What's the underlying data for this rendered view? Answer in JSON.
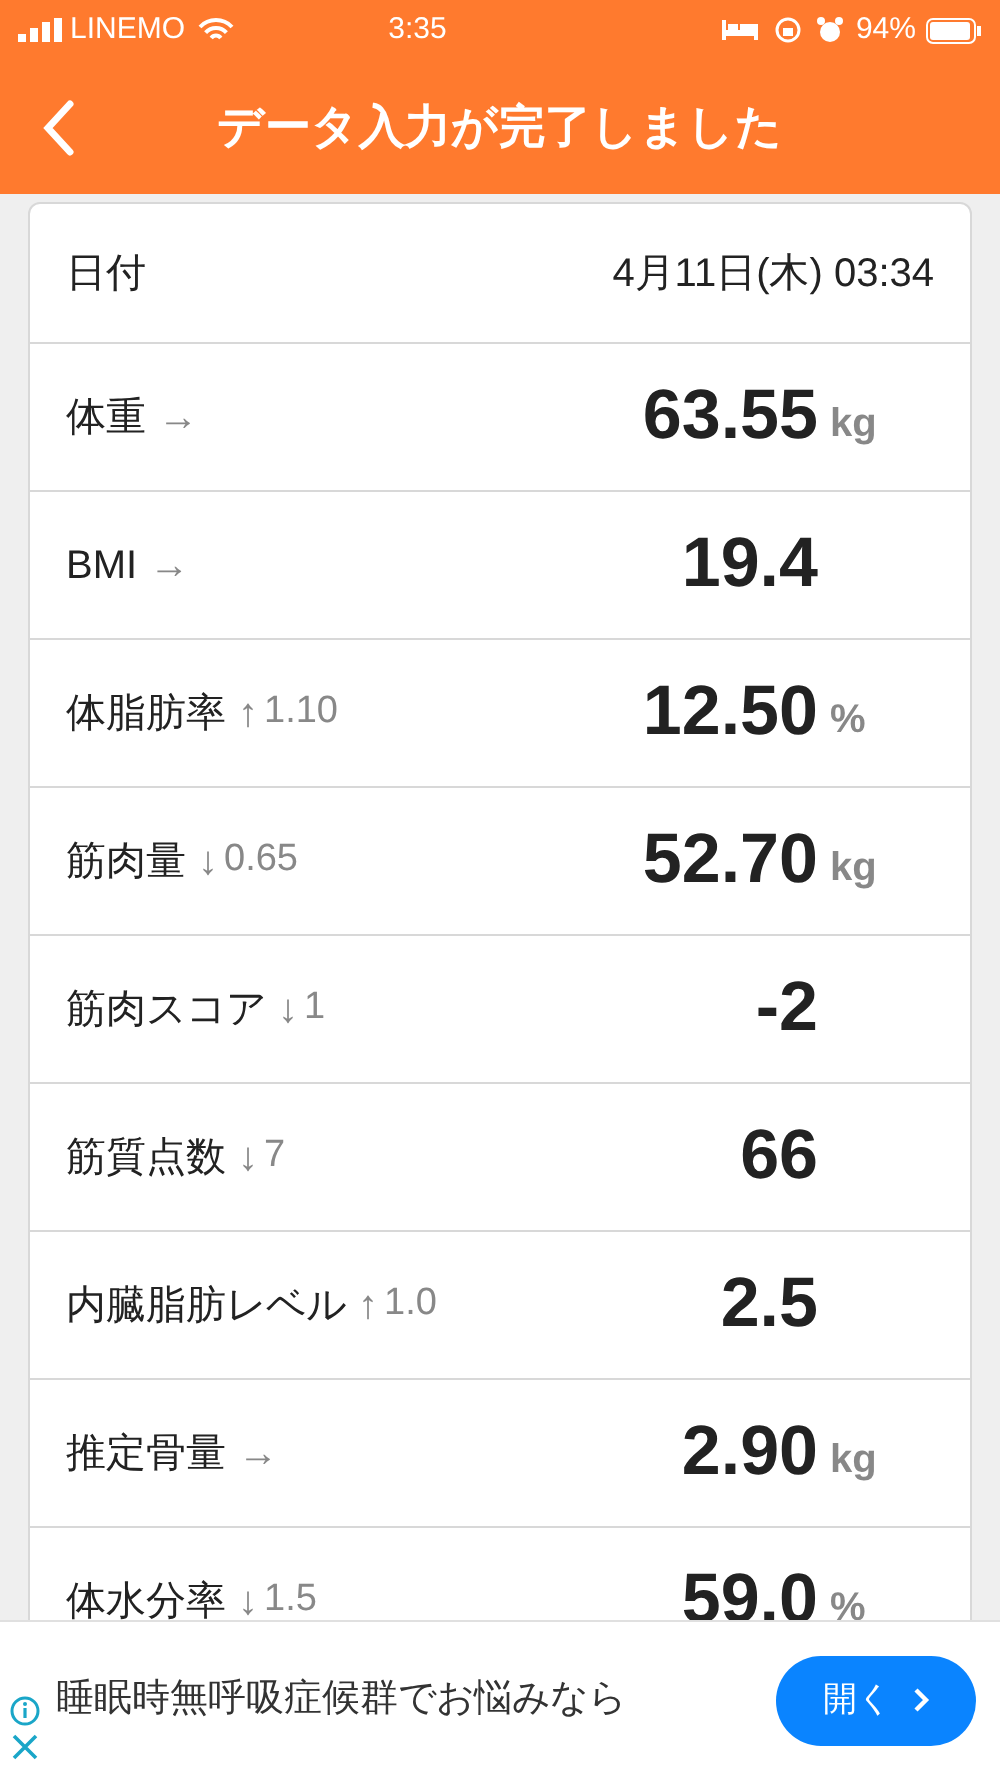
{
  "status_bar": {
    "carrier": "LINEMO",
    "time": "3:35",
    "battery": "94%"
  },
  "header": {
    "title": "データ入力が完了しました"
  },
  "date_row": {
    "label": "日付",
    "value": "4月11日(木) 03:34"
  },
  "rows": [
    {
      "label": "体重",
      "trend": "→",
      "value": "63.55",
      "unit": "kg"
    },
    {
      "label": "BMI",
      "trend": "→",
      "value": "19.4"
    },
    {
      "label": "体脂肪率",
      "trend": "↑",
      "change": "1.10",
      "value": "12.50",
      "unit": "%"
    },
    {
      "label": "筋肉量",
      "trend": "↓",
      "change": "0.65",
      "value": "52.70",
      "unit": "kg"
    },
    {
      "label": "筋肉スコア",
      "trend": "↓",
      "change": "1",
      "value": "-2"
    },
    {
      "label": "筋質点数",
      "trend": "↓",
      "change": "7",
      "value": "66"
    },
    {
      "label": "内臓脂肪レベル",
      "trend": "↑",
      "change": "1.0",
      "value": "2.5"
    },
    {
      "label": "推定骨量",
      "trend": "→",
      "value": "2.90",
      "unit": "kg"
    },
    {
      "label": "体水分率",
      "trend": "↓",
      "change": "1.5",
      "value": "59.0",
      "unit": "%"
    }
  ],
  "ad": {
    "text": "睡眠時無呼吸症候群でお悩みなら",
    "button": "開く"
  }
}
